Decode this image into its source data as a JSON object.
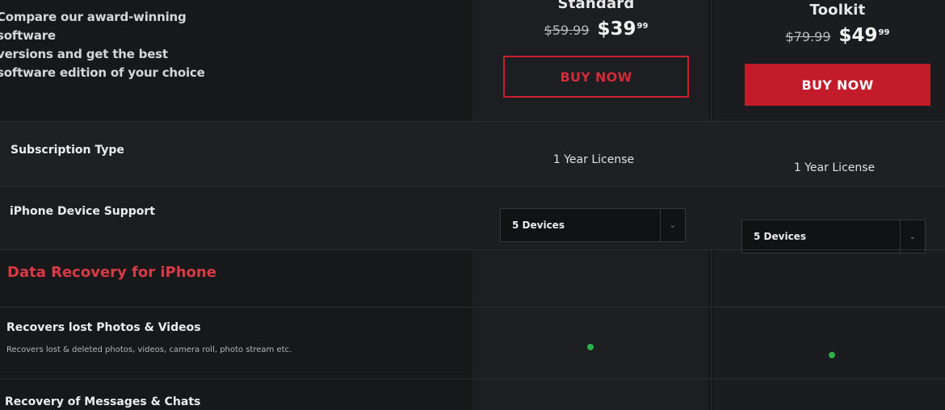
{
  "intro": {
    "line1": "Compare our award-winning software",
    "line2": "versions and get the best",
    "line3": "software edition of your choice"
  },
  "plans": [
    {
      "name": "Standard",
      "old_price": "$59.99",
      "new_price_main": "$39",
      "new_price_cents": "99",
      "button": "BUY NOW",
      "button_style": "outline"
    },
    {
      "name": "Toolkit",
      "old_price": "$79.99",
      "new_price_main": "$49",
      "new_price_cents": "99",
      "button": "BUY NOW",
      "button_style": "filled"
    }
  ],
  "rows": {
    "subscription": {
      "label": "Subscription Type",
      "values": [
        "1 Year License",
        "1 Year License"
      ]
    },
    "devices": {
      "label": "iPhone Device Support",
      "selected": [
        "5 Devices",
        "5 Devices"
      ]
    }
  },
  "section": {
    "title": "Data Recovery for iPhone"
  },
  "features": [
    {
      "title": "Recovers lost Photos & Videos",
      "desc": "Recovers lost & deleted photos, videos, camera roll, photo stream etc."
    },
    {
      "title": "Recovery of Messages & Chats"
    }
  ],
  "colors": {
    "accent": "#c21b2a",
    "check": "#2bb14a",
    "background": "#17181a"
  }
}
